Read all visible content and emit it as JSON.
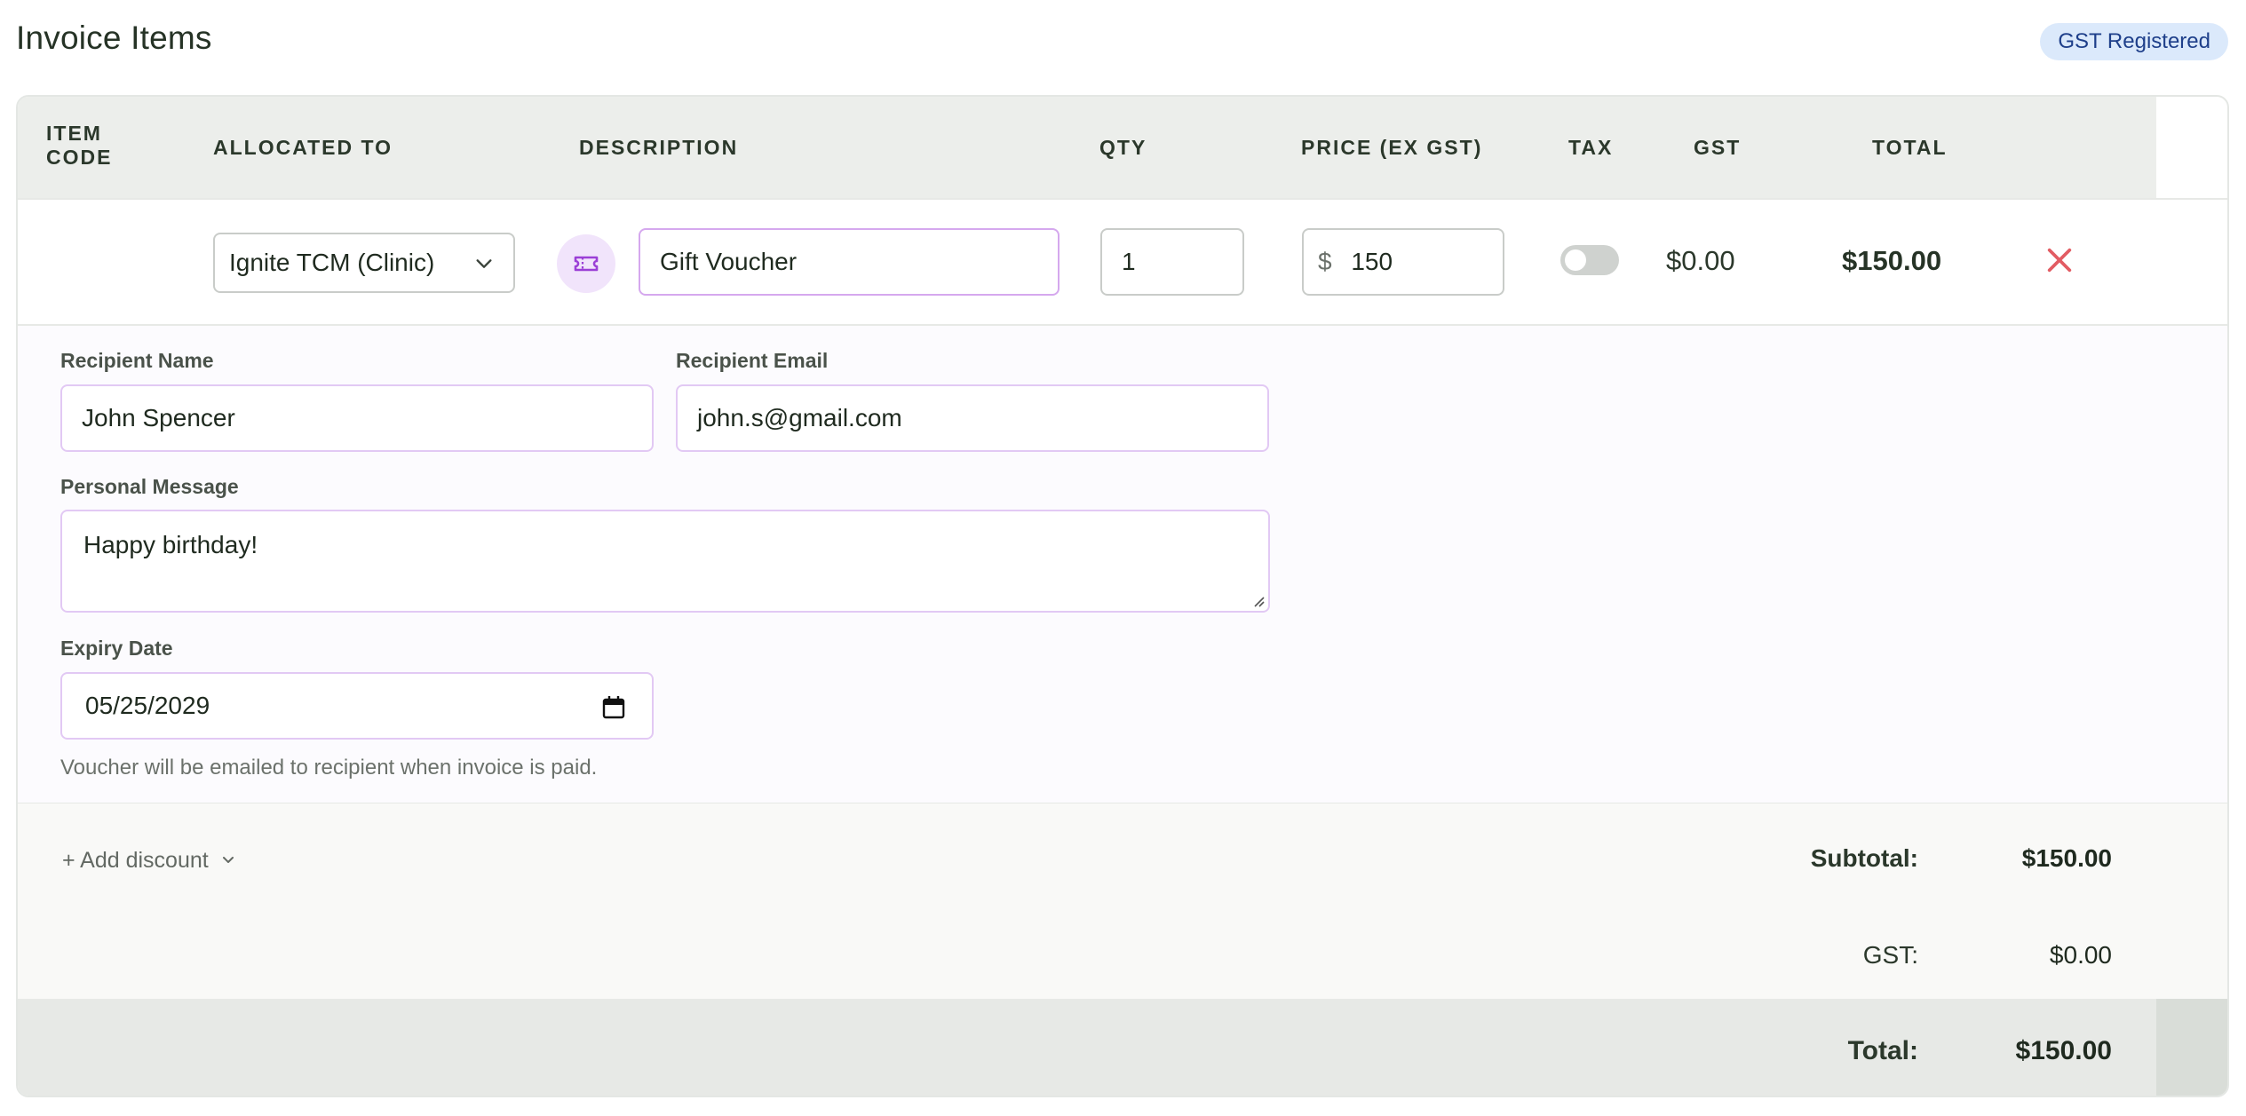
{
  "page_title": "Invoice Items",
  "badge": "GST Registered",
  "columns": {
    "item_code": "ITEM",
    "item_code_2": "CODE",
    "allocated_to": "ALLOCATED TO",
    "description": "DESCRIPTION",
    "qty": "QTY",
    "price": "PRICE (EX GST)",
    "tax": "TAX",
    "gst": "GST",
    "total": "TOTAL"
  },
  "item": {
    "allocated_to": "Ignite TCM (Clinic)",
    "description": "Gift Voucher",
    "qty": "1",
    "currency_symbol": "$",
    "price": "150",
    "tax_enabled": false,
    "gst": "$0.00",
    "total": "$150.00"
  },
  "voucher": {
    "recipient_name_label": "Recipient Name",
    "recipient_name": "John Spencer",
    "recipient_email_label": "Recipient Email",
    "recipient_email": "john.s@gmail.com",
    "message_label": "Personal Message",
    "message": "Happy birthday!",
    "expiry_label": "Expiry Date",
    "expiry_date": "05/25/2029",
    "hint": "Voucher will be emailed to recipient when invoice is paid."
  },
  "summary": {
    "add_discount": "+ Add discount",
    "subtotal_label": "Subtotal:",
    "subtotal": "$150.00",
    "gst_label": "GST:",
    "gst": "$0.00",
    "total_label": "Total:",
    "total": "$150.00"
  },
  "colors": {
    "accent_purple": "#d5a8ee",
    "remove_red": "#e25c63",
    "badge_bg": "#dbe9fb"
  }
}
